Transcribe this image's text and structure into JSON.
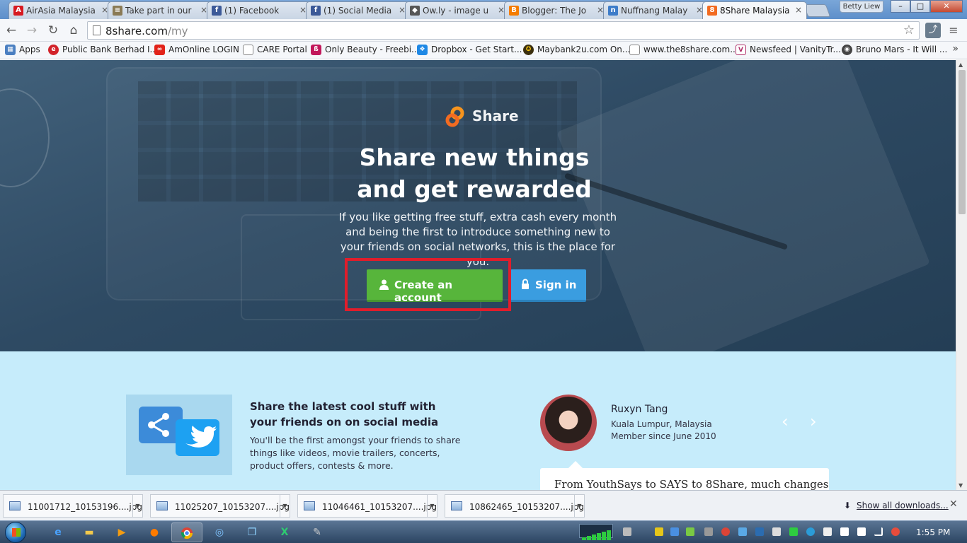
{
  "browser": {
    "tabs": [
      {
        "title": "AirAsia Malaysia",
        "icon": "airasia-icon",
        "color": "#d71920",
        "glyph": "A"
      },
      {
        "title": "Take part in our",
        "icon": "document-icon",
        "color": "#8a7a55",
        "glyph": "≡"
      },
      {
        "title": "(1) Facebook",
        "icon": "facebook-icon",
        "color": "#3b5998",
        "glyph": "f"
      },
      {
        "title": "(1) Social Media",
        "icon": "facebook-icon",
        "color": "#3b5998",
        "glyph": "f"
      },
      {
        "title": "Ow.ly - image u",
        "icon": "owl-icon",
        "color": "#555555",
        "glyph": "◆"
      },
      {
        "title": "Blogger: The Jo",
        "icon": "blogger-icon",
        "color": "#f57d00",
        "glyph": "B"
      },
      {
        "title": "Nuffnang Malay",
        "icon": "nuffnang-icon",
        "color": "#3d7cc9",
        "glyph": "n"
      },
      {
        "title": "8Share Malaysia",
        "icon": "8share-icon",
        "color": "#f26b21",
        "glyph": "8"
      }
    ],
    "profile_name": "Betty Liew",
    "url_host": "8share.com",
    "url_path": "/my"
  },
  "bookmarks": [
    {
      "label": "Apps",
      "icon": "apps-grid-icon",
      "color": "#4a7fc1",
      "glyph": "▦"
    },
    {
      "label": "Public Bank Berhad I...",
      "icon": "public-bank-icon",
      "color": "#d2232a",
      "glyph": "e"
    },
    {
      "label": "AmOnline LOGIN",
      "icon": "ambank-icon",
      "color": "#e2231a",
      "glyph": "∞"
    },
    {
      "label": "CARE Portal",
      "icon": "page-icon",
      "color": "#ffffff",
      "glyph": ""
    },
    {
      "label": "Only Beauty - Freebi...",
      "icon": "onlybeauty-icon",
      "color": "#c2185b",
      "glyph": "ß"
    },
    {
      "label": "Dropbox - Get Start...",
      "icon": "dropbox-icon",
      "color": "#1e88e5",
      "glyph": "❖"
    },
    {
      "label": "Maybank2u.com On...",
      "icon": "maybank-icon",
      "color": "#3b2f0e",
      "glyph": "✪"
    },
    {
      "label": "www.the8share.com...",
      "icon": "page-icon",
      "color": "#ffffff",
      "glyph": ""
    },
    {
      "label": "Newsfeed | VanityTr...",
      "icon": "vanitytrove-icon",
      "color": "#b0306a",
      "glyph": "V"
    },
    {
      "label": "Bruno Mars - It Will ...",
      "icon": "music-icon",
      "color": "#444444",
      "glyph": "◉"
    }
  ],
  "hero": {
    "brand_name": "Share",
    "headline_line1": "Share new things",
    "headline_line2": "and get rewarded",
    "subtext": "If you like getting free stuff, extra cash every month and being the first to introduce something new to your friends on social networks, this is the place for you.",
    "create_account_label": "Create an account",
    "sign_in_label": "Sign in"
  },
  "feature": {
    "title": "Share the latest cool stuff with your friends on on social media",
    "text": "You'll be the first amongst your friends to share things like videos, movie trailers, concerts, product offers, contests & more."
  },
  "testimonial": {
    "name": "Ruxyn Tang",
    "location": "Kuala Lumpur, Malaysia",
    "member_since": "Member since June 2010",
    "quote": "From YouthSays to SAYS to 8Share, much changes"
  },
  "downloads": {
    "items": [
      "11001712_10153196....jpg",
      "11025207_10153207....jpg",
      "11046461_10153207....jpg",
      "10862465_10153207....jpg"
    ],
    "show_all": "Show all downloads..."
  },
  "taskbar": {
    "clock": "1:55 PM"
  },
  "colors": {
    "create_button": "#57b53b",
    "signin_button": "#3a9de0",
    "highlight_box": "#e11d2b",
    "lower_section_bg": "#c6ecfb"
  }
}
